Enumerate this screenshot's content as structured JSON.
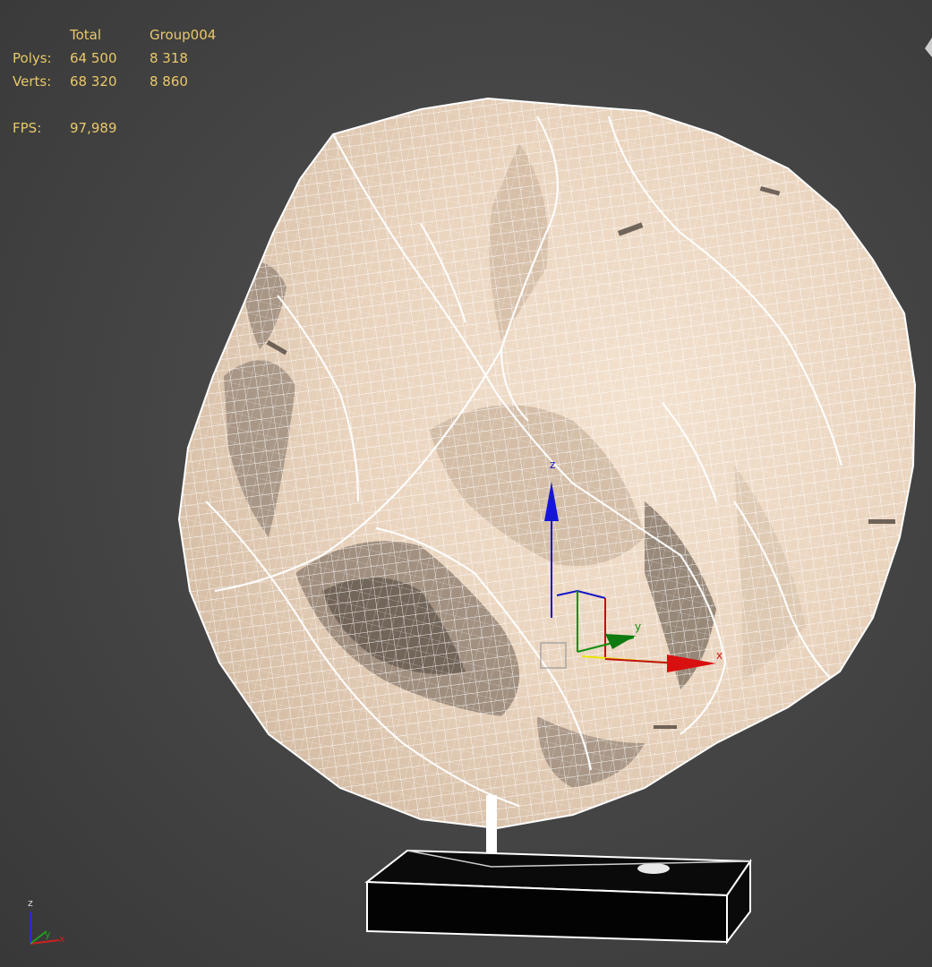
{
  "stats": {
    "header": {
      "total": "Total",
      "object": "Group004"
    },
    "polys": {
      "label": "Polys:",
      "total": "64 500",
      "object": "8 318"
    },
    "verts": {
      "label": "Verts:",
      "total": "68 320",
      "object": "8 860"
    },
    "fps": {
      "label": "FPS:",
      "value": "97,989"
    }
  },
  "gizmo_labels": {
    "z": "z",
    "y": "y",
    "x": "x"
  },
  "view_axis_labels": {
    "z": "z",
    "y": "y",
    "x": "x"
  },
  "colors": {
    "background": "#464646",
    "stats_text": "#e9c86a",
    "mesh_fill": "#efdcc8",
    "mesh_shadow": "#6b5e53",
    "wire": "#ffffff",
    "axis_x": "#d01010",
    "axis_y": "#109010",
    "axis_z": "#1010d0",
    "base": "#050505"
  },
  "icons": [
    "transform-gizmo-icon",
    "view-axis-tripod-icon"
  ]
}
